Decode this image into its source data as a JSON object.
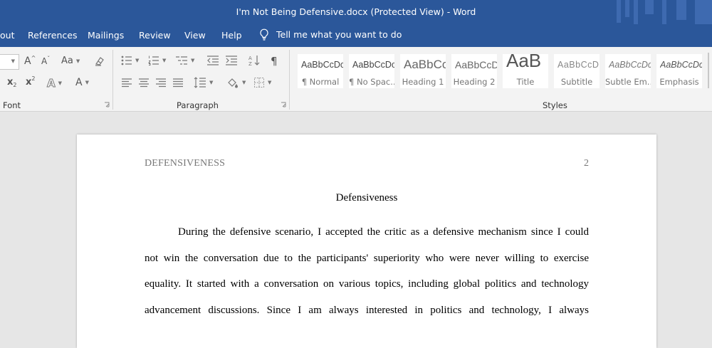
{
  "window": {
    "title": "I'm Not Being Defensive.docx (Protected View)  -  Word"
  },
  "tabs": {
    "items": [
      {
        "label": "out"
      },
      {
        "label": "References"
      },
      {
        "label": "Mailings"
      },
      {
        "label": "Review"
      },
      {
        "label": "View"
      },
      {
        "label": "Help"
      }
    ],
    "tell_me": "Tell me what you want to do"
  },
  "ribbon": {
    "font_group": {
      "label": "Font",
      "grow_glyph": "A",
      "shrink_glyph": "A",
      "case_glyph": "Aa",
      "sub_glyph": "x",
      "sub_index": "2",
      "sup_glyph": "x",
      "sup_index": "2",
      "effects_glyph": "A",
      "color_glyph": "A"
    },
    "paragraph_group": {
      "label": "Paragraph",
      "pilcrow": "¶"
    },
    "styles_group": {
      "label": "Styles",
      "items": [
        {
          "sample": "AaBbCcDc",
          "name": "¶ Normal"
        },
        {
          "sample": "AaBbCcDc",
          "name": "¶ No Spac..."
        },
        {
          "sample": "AaBbCc",
          "name": "Heading 1"
        },
        {
          "sample": "AaBbCcD",
          "name": "Heading 2"
        },
        {
          "sample": "AaB",
          "name": "Title"
        },
        {
          "sample": "AaBbCcD",
          "name": "Subtitle"
        },
        {
          "sample": "AaBbCcDc",
          "name": "Subtle Em..."
        },
        {
          "sample": "AaBbCcDc",
          "name": "Emphasis"
        }
      ]
    }
  },
  "colors": {
    "accent": "#2b579a",
    "ribbon": "#f3f3f3",
    "canvas": "#e6e6e6"
  },
  "document": {
    "running_head": "DEFENSIVENESS",
    "page_number": "2",
    "title": "Defensiveness",
    "lines": [
      "During the defensive scenario, I accepted the critic as a defensive mechanism since I could",
      "not win the conversation due to the participants' superiority who were never willing to exercise",
      "equality. It started with a conversation on various topics, including global politics and technology",
      "advancement discussions. Since I am always interested in politics and technology, I always"
    ]
  }
}
